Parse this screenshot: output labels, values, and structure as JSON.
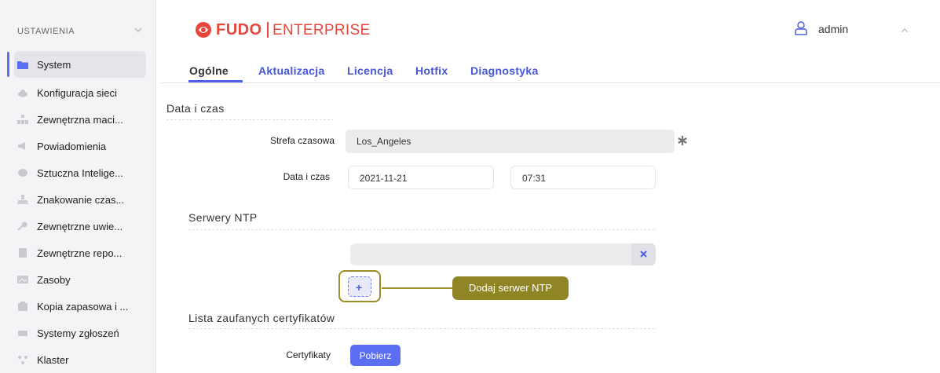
{
  "sidebar": {
    "title": "USTAWIENIA",
    "items": [
      {
        "label": "System",
        "icon": "folder-icon"
      },
      {
        "label": "Konfiguracja sieci",
        "icon": "cloud-icon"
      },
      {
        "label": "Zewnętrzna maci...",
        "icon": "network-icon"
      },
      {
        "label": "Powiadomienia",
        "icon": "megaphone-icon"
      },
      {
        "label": "Sztuczna Intelige...",
        "icon": "brain-icon"
      },
      {
        "label": "Znakowanie czas...",
        "icon": "stamp-icon"
      },
      {
        "label": "Zewnętrzne uwie...",
        "icon": "key-icon"
      },
      {
        "label": "Zewnętrzne repo...",
        "icon": "repository-icon"
      },
      {
        "label": "Zasoby",
        "icon": "image-icon"
      },
      {
        "label": "Kopia zapasowa i ...",
        "icon": "backup-icon"
      },
      {
        "label": "Systemy zgłoszeń",
        "icon": "ticket-icon"
      },
      {
        "label": "Klaster",
        "icon": "cluster-icon"
      }
    ]
  },
  "header": {
    "brand_fudo": "FUDO",
    "brand_enterprise": "ENTERPRISE",
    "user": "admin"
  },
  "tabs": [
    "Ogólne",
    "Aktualizacja",
    "Licencja",
    "Hotfix",
    "Diagnostyka"
  ],
  "sections": {
    "datetime": {
      "title": "Data i czas",
      "timezone_label": "Strefa czasowa",
      "timezone_value": "Los_Angeles",
      "datetime_label": "Data i czas",
      "date_value": "2021-11-21",
      "time_value": "07:31"
    },
    "ntp": {
      "title": "Serwery NTP",
      "server_value": "",
      "add_icon": "+",
      "remove_icon": "×",
      "callout": "Dodaj serwer NTP"
    },
    "certs": {
      "title": "Lista zaufanych certyfikatów",
      "label": "Certyfikaty",
      "button": "Pobierz"
    }
  },
  "colors": {
    "accent": "#5b6df0",
    "brand": "#e8453c",
    "callout": "#8f8524"
  }
}
